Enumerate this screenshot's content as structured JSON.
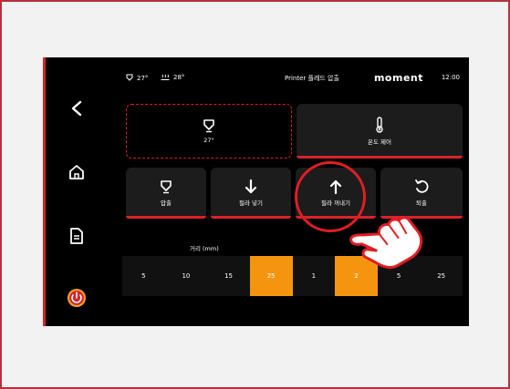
{
  "status": {
    "nozzle_temp": "27°",
    "bed_temp": "28°",
    "title": "Printer 플레드 압출",
    "brand": "moment",
    "time": "12:00"
  },
  "cards": {
    "nozzle_temp_value": "27°",
    "temp_control_label": "온도 제어",
    "extrude_label": "압출",
    "filament_insert_label": "필라 넣기",
    "filament_remove_label": "필라 꺼내기",
    "retract_label": "퇴출"
  },
  "distance": {
    "label": "거리 (mm)",
    "values": [
      "5",
      "10",
      "15",
      "25",
      "1",
      "2",
      "5",
      "25"
    ],
    "selected": [
      "25",
      "2"
    ]
  },
  "colors": {
    "accent_red": "#d8232a",
    "selected_orange": "#f5950f"
  }
}
